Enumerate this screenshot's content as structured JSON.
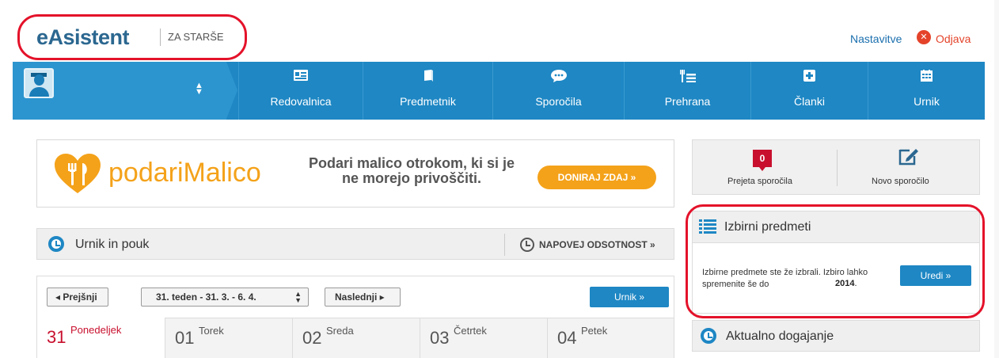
{
  "header": {
    "logo": "eAsistent",
    "logo_sub": "ZA STARŠE",
    "settings_link": "Nastavitve",
    "logout_link": "Odjava",
    "logout_icon": "close-circle-icon",
    "accent_color": "#1e87c4",
    "highlight_color": "#e4122a"
  },
  "nav": {
    "items": [
      {
        "label": "Redovalnica",
        "icon": "id-card-icon"
      },
      {
        "label": "Predmetnik",
        "icon": "book-icon"
      },
      {
        "label": "Sporočila",
        "icon": "chat-icon"
      },
      {
        "label": "Prehrana",
        "icon": "food-icon"
      },
      {
        "label": "Članki",
        "icon": "plus-square-icon"
      },
      {
        "label": "Urnik",
        "icon": "calendar-icon"
      }
    ]
  },
  "banner": {
    "brand": "podariMalico",
    "message": "Podari malico otrokom, ki si je ne morejo privoščiti.",
    "button": "DONIRAJ ZDAJ »",
    "brand_color": "#f4a21a"
  },
  "schedule": {
    "title": "Urnik in pouk",
    "absence_link": "NAPOVEJ ODSOTNOST »",
    "prev_button": "◂  Prejšnji",
    "week_select": "31. teden - 31. 3. - 6. 4.",
    "next_button": "Naslednji  ▸",
    "urnik_button": "Urnik »",
    "days": [
      {
        "num": "31",
        "name": "Ponedeljek",
        "active": true
      },
      {
        "num": "01",
        "name": "Torek",
        "active": false
      },
      {
        "num": "02",
        "name": "Sreda",
        "active": false
      },
      {
        "num": "03",
        "name": "Četrtek",
        "active": false
      },
      {
        "num": "04",
        "name": "Petek",
        "active": false
      }
    ]
  },
  "messages": {
    "count": "0",
    "received_label": "Prejeta sporočila",
    "new_label": "Novo sporočilo"
  },
  "elective": {
    "title": "Izbirni predmeti",
    "text": "Izbirne predmete ste že izbrali. Izbiro lahko spremenite še do",
    "date": "2014",
    "date_suffix": ".",
    "button": "Uredi »"
  },
  "current": {
    "title": "Aktualno dogajanje"
  }
}
